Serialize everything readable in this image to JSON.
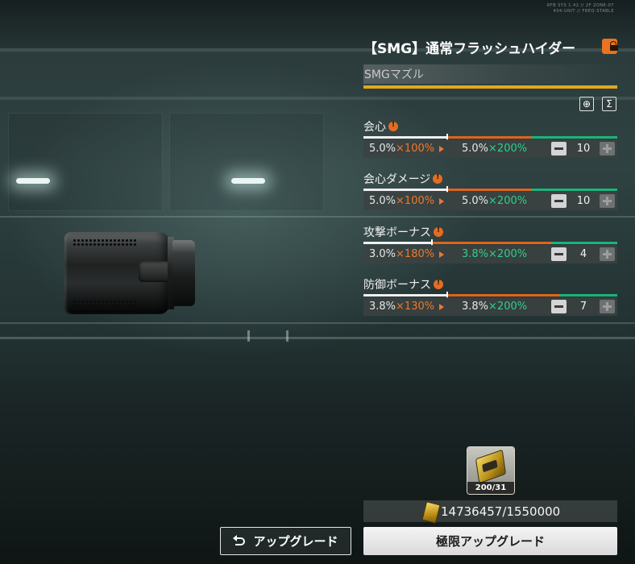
{
  "corner_code": [
    "RFB SYS 1.42 // 2F ZONE-07",
    "404-UNIT // FREQ-STABLE"
  ],
  "item": {
    "title": "【SMG】通常フラッシュハイダー",
    "subtitle": "SMGマズル",
    "locked": true
  },
  "stats": [
    {
      "name": "会心",
      "current": "5.0%",
      "current_mul": "×100%",
      "next": "5.0%",
      "next_mul": "×200%",
      "count": "10",
      "next_highlight": false,
      "white_fill": 0.33,
      "orange_fill": 0.66
    },
    {
      "name": "会心ダメージ",
      "current": "5.0%",
      "current_mul": "×100%",
      "next": "5.0%",
      "next_mul": "×200%",
      "count": "10",
      "next_highlight": false,
      "white_fill": 0.33,
      "orange_fill": 0.66
    },
    {
      "name": "攻撃ボーナス",
      "current": "3.0%",
      "current_mul": "×180%",
      "next": "3.8%",
      "next_mul": "×200%",
      "count": "4",
      "next_highlight": true,
      "white_fill": 0.27,
      "orange_fill": 0.74
    },
    {
      "name": "防御ボーナス",
      "current": "3.8%",
      "current_mul": "×130%",
      "next": "3.8%",
      "next_mul": "×200%",
      "count": "7",
      "next_highlight": false,
      "white_fill": 0.33,
      "orange_fill": 0.77
    }
  ],
  "material": {
    "quantity": "200/31"
  },
  "currency": {
    "amount": "14736457/1550000"
  },
  "buttons": {
    "upgrade": "アップグレード",
    "limit_upgrade": "極限アップグレード"
  },
  "colors": {
    "accent_gold": "#e1a81f",
    "orange": "#e0641c",
    "green": "#1db37a"
  }
}
